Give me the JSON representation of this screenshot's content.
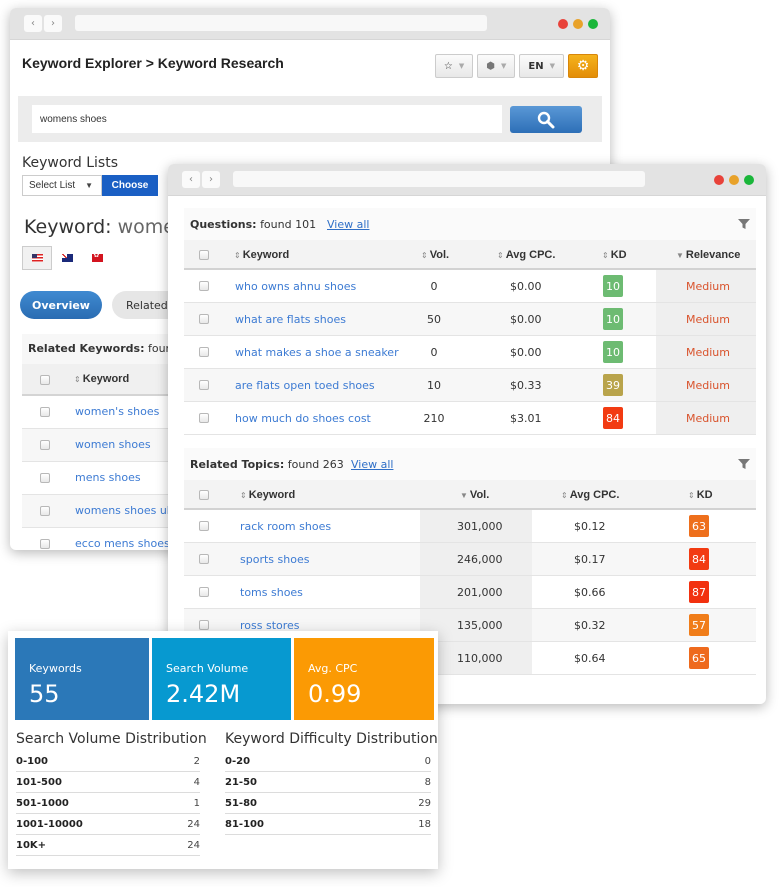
{
  "back_window": {
    "breadcrumb": "Keyword Explorer > Keyword Research",
    "toolbar": {
      "star_icon": "star-icon",
      "cube_icon": "cube-icon",
      "language": "EN",
      "settings_icon": "gear-icon"
    },
    "search": {
      "value": "womens shoes",
      "button_icon": "search-icon"
    },
    "keyword_lists": {
      "label": "Keyword Lists",
      "select_value": "Select List",
      "choose_label": "Choose"
    },
    "keyword_heading": {
      "label": "Keyword:",
      "value": "womens shoes"
    },
    "flags": [
      "us-flag",
      "au-flag",
      "hk-flag"
    ],
    "tabs": {
      "overview": "Overview",
      "related": "Related"
    },
    "related_keywords": {
      "title_bold": "Related Keywords:",
      "title_rest": "found",
      "column_keyword": "Keyword",
      "rows": [
        "women's shoes",
        "women shoes",
        "mens shoes",
        "womens shoes uk",
        "ecco mens shoes"
      ]
    }
  },
  "front_window": {
    "questions": {
      "title_bold": "Questions:",
      "title_rest": "found 101",
      "view_all": "View all",
      "columns": [
        "Keyword",
        "Vol.",
        "Avg CPC.",
        "KD",
        "Relevance"
      ],
      "rows": [
        {
          "keyword": "who owns ahnu shoes",
          "vol": "0",
          "cpc": "$0.00",
          "kd": "10",
          "kd_color": "#6dbb72",
          "relevance": "Medium"
        },
        {
          "keyword": "what are flats shoes",
          "vol": "50",
          "cpc": "$0.00",
          "kd": "10",
          "kd_color": "#6dbb72",
          "relevance": "Medium"
        },
        {
          "keyword": "what makes a shoe a sneaker",
          "vol": "0",
          "cpc": "$0.00",
          "kd": "10",
          "kd_color": "#6dbb72",
          "relevance": "Medium"
        },
        {
          "keyword": "are flats open toed shoes",
          "vol": "10",
          "cpc": "$0.33",
          "kd": "39",
          "kd_color": "#b9a44c",
          "relevance": "Medium"
        },
        {
          "keyword": "how much do shoes cost",
          "vol": "210",
          "cpc": "$3.01",
          "kd": "84",
          "kd_color": "#f23b12",
          "relevance": "Medium"
        }
      ]
    },
    "related_topics": {
      "title_bold": "Related Topics:",
      "title_rest": "found 263",
      "view_all": "View all",
      "columns": [
        "Keyword",
        "Vol.",
        "Avg CPC.",
        "KD"
      ],
      "rows": [
        {
          "keyword": "rack room shoes",
          "vol": "301,000",
          "cpc": "$0.12",
          "kd": "63",
          "kd_color": "#ee6f1c"
        },
        {
          "keyword": "sports shoes",
          "vol": "246,000",
          "cpc": "$0.17",
          "kd": "84",
          "kd_color": "#f23b12"
        },
        {
          "keyword": "toms shoes",
          "vol": "201,000",
          "cpc": "$0.66",
          "kd": "87",
          "kd_color": "#f2310f"
        },
        {
          "keyword": "ross stores",
          "vol": "135,000",
          "cpc": "$0.32",
          "kd": "57",
          "kd_color": "#f07d1a"
        },
        {
          "keyword": "",
          "vol": "110,000",
          "cpc": "$0.64",
          "kd": "65",
          "kd_color": "#ee6a1d"
        }
      ]
    }
  },
  "summary": {
    "tiles": [
      {
        "label": "Keywords",
        "value": "55",
        "color": "#2b78b8"
      },
      {
        "label": "Search Volume",
        "value": "2.42M",
        "color": "#0799d0"
      },
      {
        "label": "Avg. CPC",
        "value": "0.99",
        "color": "#fb9a04"
      }
    ],
    "search_volume_distribution": {
      "title": "Search Volume Distribution",
      "rows": [
        {
          "range": "0-100",
          "count": "2"
        },
        {
          "range": "101-500",
          "count": "4"
        },
        {
          "range": "501-1000",
          "count": "1"
        },
        {
          "range": "1001-10000",
          "count": "24"
        },
        {
          "range": "10K+",
          "count": "24"
        }
      ]
    },
    "keyword_difficulty_distribution": {
      "title": "Keyword Difficulty Distribution",
      "rows": [
        {
          "range": "0-20",
          "count": "0"
        },
        {
          "range": "21-50",
          "count": "8"
        },
        {
          "range": "51-80",
          "count": "29"
        },
        {
          "range": "81-100",
          "count": "18"
        }
      ]
    }
  }
}
